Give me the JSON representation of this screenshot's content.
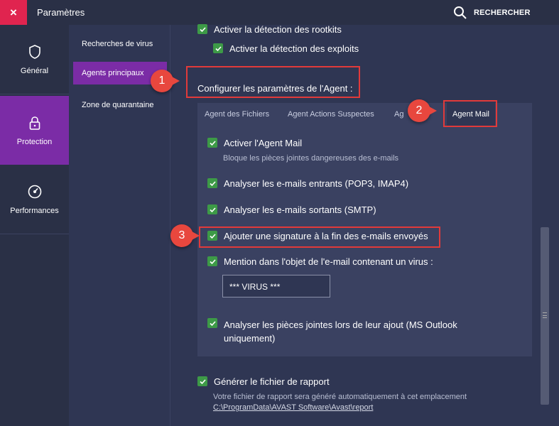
{
  "titlebar": {
    "close_label": "×",
    "title": "Paramètres",
    "search_label": "RECHERCHER"
  },
  "leftnav": {
    "items": [
      {
        "label": "Général",
        "icon": "shield-icon"
      },
      {
        "label": "Protection",
        "icon": "lock-icon"
      },
      {
        "label": "Performances",
        "icon": "speedometer-icon"
      }
    ]
  },
  "subnav": {
    "items": [
      {
        "label": "Recherches de virus"
      },
      {
        "label": "Agents principaux"
      },
      {
        "label": "Zone de quarantaine"
      }
    ]
  },
  "content": {
    "rootkits_label": "Activer la détection des rootkits",
    "exploits_label": "Activer la détection des exploits",
    "configure_label": "Configurer les paramètres de l'Agent :",
    "tabs": [
      {
        "label": "Agent des Fichiers"
      },
      {
        "label": "Agent Actions Suspectes"
      },
      {
        "label": "Ag"
      },
      {
        "label": "Agent Mail"
      }
    ],
    "mail": {
      "enable_label": "Activer l'Agent Mail",
      "enable_desc": "Bloque les pièces jointes dangereuses des e-mails",
      "incoming_label": "Analyser les e-mails entrants (POP3, IMAP4)",
      "outgoing_label": "Analyser les e-mails sortants (SMTP)",
      "signature_label": "Ajouter une signature à la fin des e-mails envoyés",
      "subject_label": "Mention dans l'objet de l'e-mail contenant un virus :",
      "subject_value": "*** VIRUS ***",
      "attachments_label": "Analyser les pièces jointes lors de leur ajout (MS Outlook uniquement)"
    },
    "report_label": "Générer le fichier de rapport",
    "report_desc": "Votre fichier de rapport sera généré automatiquement à cet emplacement",
    "report_path": "C:\\ProgramData\\AVAST Software\\Avast\\report"
  },
  "annotations": {
    "badge1": "1",
    "badge2": "2",
    "badge3": "3"
  },
  "colors": {
    "accent": "#7b2ca6",
    "close": "#e0244f",
    "checkbox": "#3d9a47",
    "highlight": "#e13a3a"
  }
}
